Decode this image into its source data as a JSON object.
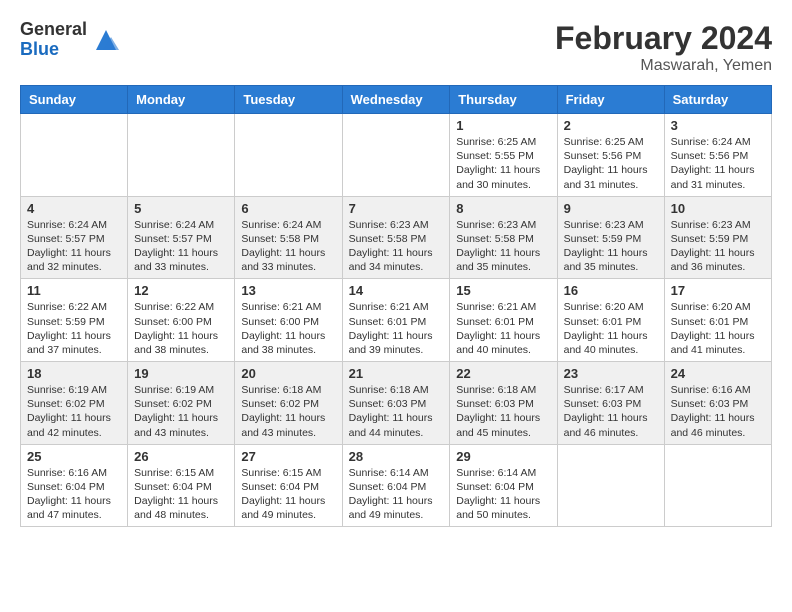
{
  "header": {
    "logo_general": "General",
    "logo_blue": "Blue",
    "title": "February 2024",
    "subtitle": "Maswarah, Yemen"
  },
  "calendar": {
    "days_of_week": [
      "Sunday",
      "Monday",
      "Tuesday",
      "Wednesday",
      "Thursday",
      "Friday",
      "Saturday"
    ],
    "weeks": [
      {
        "days": [
          {
            "num": "",
            "info": ""
          },
          {
            "num": "",
            "info": ""
          },
          {
            "num": "",
            "info": ""
          },
          {
            "num": "",
            "info": ""
          },
          {
            "num": "1",
            "info": "Sunrise: 6:25 AM\nSunset: 5:55 PM\nDaylight: 11 hours\nand 30 minutes."
          },
          {
            "num": "2",
            "info": "Sunrise: 6:25 AM\nSunset: 5:56 PM\nDaylight: 11 hours\nand 31 minutes."
          },
          {
            "num": "3",
            "info": "Sunrise: 6:24 AM\nSunset: 5:56 PM\nDaylight: 11 hours\nand 31 minutes."
          }
        ]
      },
      {
        "days": [
          {
            "num": "4",
            "info": "Sunrise: 6:24 AM\nSunset: 5:57 PM\nDaylight: 11 hours\nand 32 minutes."
          },
          {
            "num": "5",
            "info": "Sunrise: 6:24 AM\nSunset: 5:57 PM\nDaylight: 11 hours\nand 33 minutes."
          },
          {
            "num": "6",
            "info": "Sunrise: 6:24 AM\nSunset: 5:58 PM\nDaylight: 11 hours\nand 33 minutes."
          },
          {
            "num": "7",
            "info": "Sunrise: 6:23 AM\nSunset: 5:58 PM\nDaylight: 11 hours\nand 34 minutes."
          },
          {
            "num": "8",
            "info": "Sunrise: 6:23 AM\nSunset: 5:58 PM\nDaylight: 11 hours\nand 35 minutes."
          },
          {
            "num": "9",
            "info": "Sunrise: 6:23 AM\nSunset: 5:59 PM\nDaylight: 11 hours\nand 35 minutes."
          },
          {
            "num": "10",
            "info": "Sunrise: 6:23 AM\nSunset: 5:59 PM\nDaylight: 11 hours\nand 36 minutes."
          }
        ]
      },
      {
        "days": [
          {
            "num": "11",
            "info": "Sunrise: 6:22 AM\nSunset: 5:59 PM\nDaylight: 11 hours\nand 37 minutes."
          },
          {
            "num": "12",
            "info": "Sunrise: 6:22 AM\nSunset: 6:00 PM\nDaylight: 11 hours\nand 38 minutes."
          },
          {
            "num": "13",
            "info": "Sunrise: 6:21 AM\nSunset: 6:00 PM\nDaylight: 11 hours\nand 38 minutes."
          },
          {
            "num": "14",
            "info": "Sunrise: 6:21 AM\nSunset: 6:01 PM\nDaylight: 11 hours\nand 39 minutes."
          },
          {
            "num": "15",
            "info": "Sunrise: 6:21 AM\nSunset: 6:01 PM\nDaylight: 11 hours\nand 40 minutes."
          },
          {
            "num": "16",
            "info": "Sunrise: 6:20 AM\nSunset: 6:01 PM\nDaylight: 11 hours\nand 40 minutes."
          },
          {
            "num": "17",
            "info": "Sunrise: 6:20 AM\nSunset: 6:01 PM\nDaylight: 11 hours\nand 41 minutes."
          }
        ]
      },
      {
        "days": [
          {
            "num": "18",
            "info": "Sunrise: 6:19 AM\nSunset: 6:02 PM\nDaylight: 11 hours\nand 42 minutes."
          },
          {
            "num": "19",
            "info": "Sunrise: 6:19 AM\nSunset: 6:02 PM\nDaylight: 11 hours\nand 43 minutes."
          },
          {
            "num": "20",
            "info": "Sunrise: 6:18 AM\nSunset: 6:02 PM\nDaylight: 11 hours\nand 43 minutes."
          },
          {
            "num": "21",
            "info": "Sunrise: 6:18 AM\nSunset: 6:03 PM\nDaylight: 11 hours\nand 44 minutes."
          },
          {
            "num": "22",
            "info": "Sunrise: 6:18 AM\nSunset: 6:03 PM\nDaylight: 11 hours\nand 45 minutes."
          },
          {
            "num": "23",
            "info": "Sunrise: 6:17 AM\nSunset: 6:03 PM\nDaylight: 11 hours\nand 46 minutes."
          },
          {
            "num": "24",
            "info": "Sunrise: 6:16 AM\nSunset: 6:03 PM\nDaylight: 11 hours\nand 46 minutes."
          }
        ]
      },
      {
        "days": [
          {
            "num": "25",
            "info": "Sunrise: 6:16 AM\nSunset: 6:04 PM\nDaylight: 11 hours\nand 47 minutes."
          },
          {
            "num": "26",
            "info": "Sunrise: 6:15 AM\nSunset: 6:04 PM\nDaylight: 11 hours\nand 48 minutes."
          },
          {
            "num": "27",
            "info": "Sunrise: 6:15 AM\nSunset: 6:04 PM\nDaylight: 11 hours\nand 49 minutes."
          },
          {
            "num": "28",
            "info": "Sunrise: 6:14 AM\nSunset: 6:04 PM\nDaylight: 11 hours\nand 49 minutes."
          },
          {
            "num": "29",
            "info": "Sunrise: 6:14 AM\nSunset: 6:04 PM\nDaylight: 11 hours\nand 50 minutes."
          },
          {
            "num": "",
            "info": ""
          },
          {
            "num": "",
            "info": ""
          }
        ]
      }
    ]
  }
}
